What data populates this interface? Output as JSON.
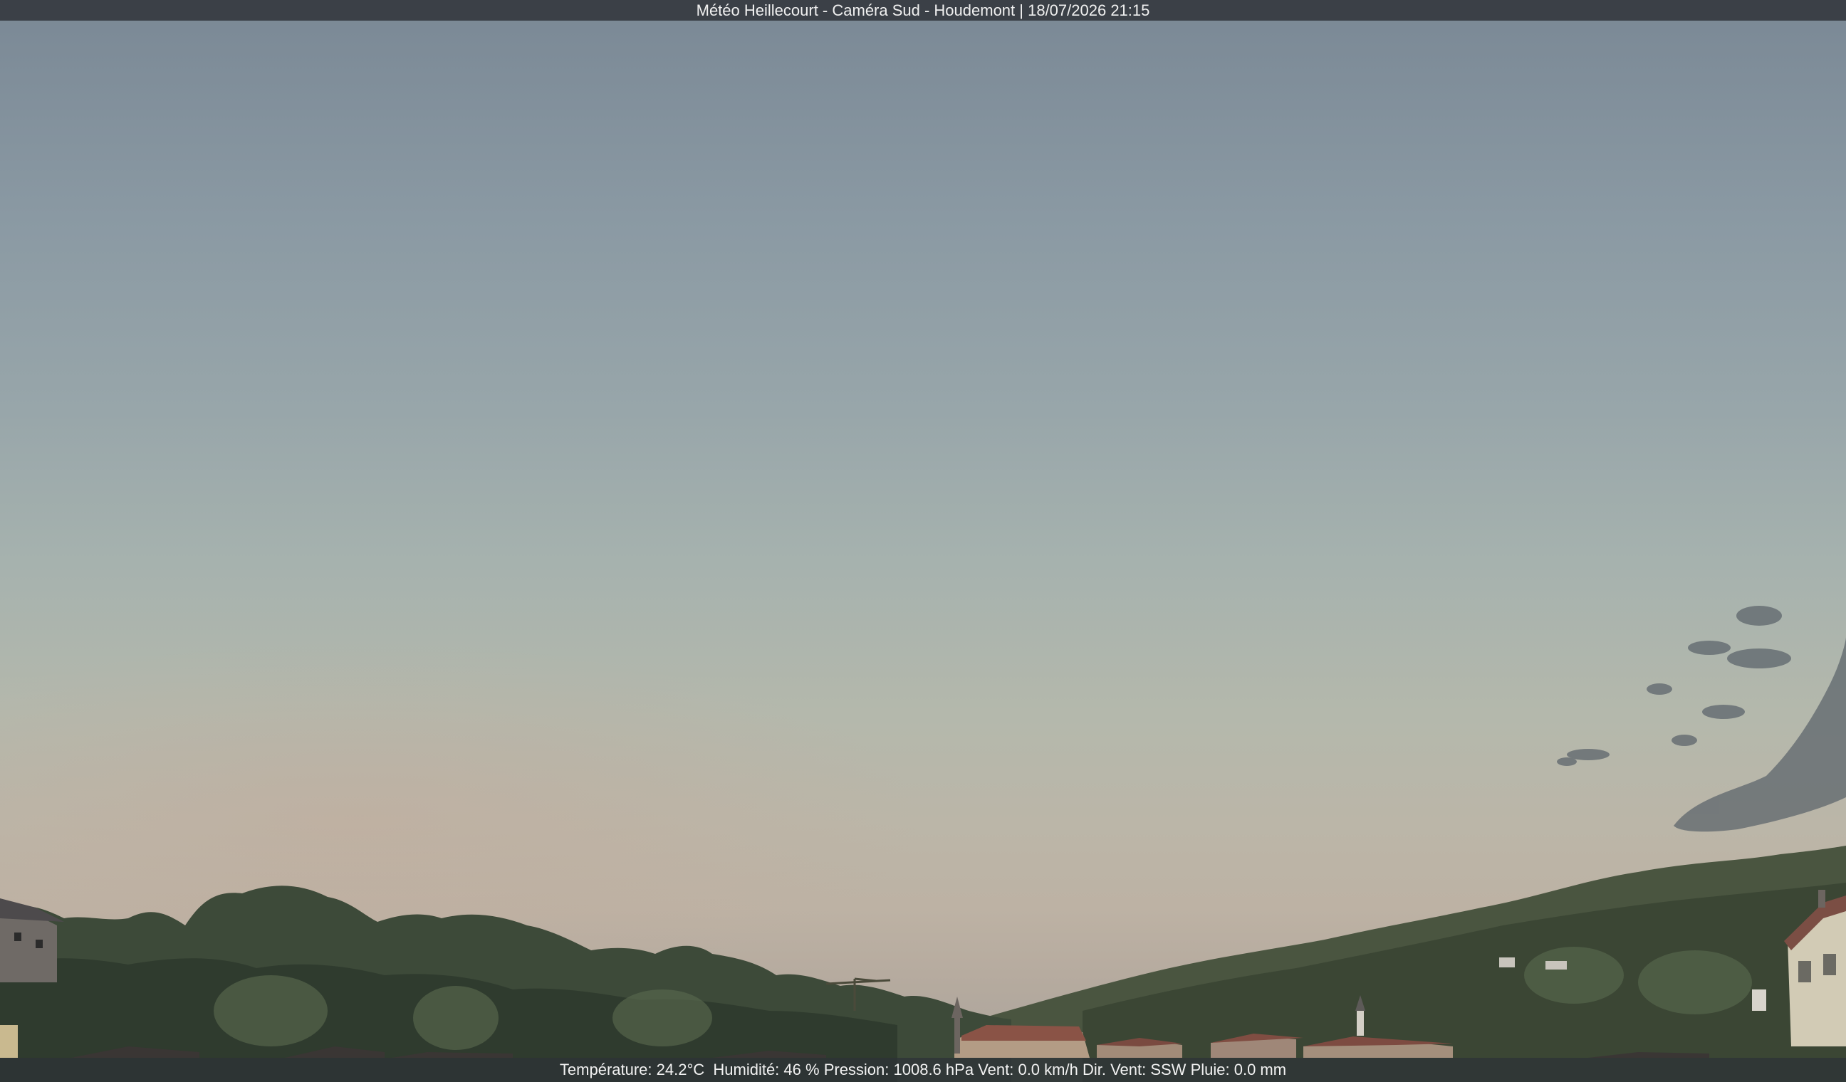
{
  "overlay": {
    "title": "Météo Heillecourt - Caméra Sud - Houdemont | 18/07/2026 21:15",
    "temperature": "Température: 24.2°C",
    "humidity": "Humidité: 46 %",
    "pressure": "Pression: 1008.6 hPa",
    "wind": "Vent: 0.0 km/h",
    "wind_direction": "Dir. Vent: SSW",
    "rain": "Pluie: 0.0 mm"
  },
  "scene": {
    "sky_top_color": "#7a8895",
    "sky_horizon_color": "#bdb2a4",
    "vegetation_color": "#3c4a38",
    "roof_color": "#8a5346"
  }
}
